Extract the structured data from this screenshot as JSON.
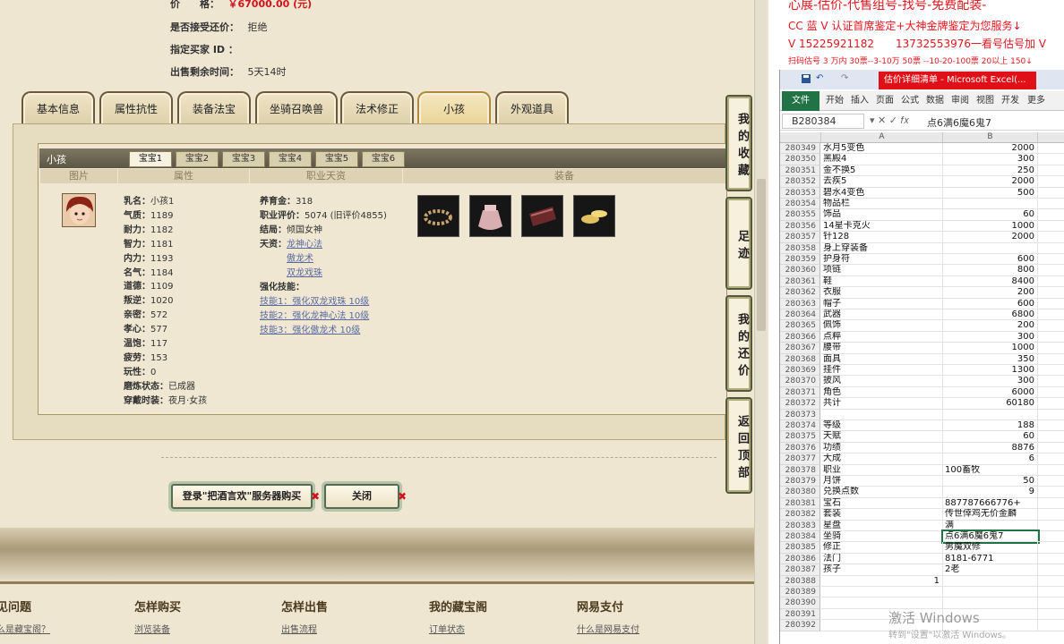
{
  "listing": {
    "price_label": "价　　格：",
    "price_value": "￥67000.00 (元)",
    "counter_offer_label": "是否接受还价：",
    "counter_offer_value": "拒绝",
    "buyer_id_label": "指定买家 ID ：",
    "buyer_id_value": "",
    "time_left_label": "出售剩余时间：",
    "time_left_value": "5天14时"
  },
  "tabs": [
    {
      "label": "基本信息",
      "active": false
    },
    {
      "label": "属性抗性",
      "active": false
    },
    {
      "label": "装备法宝",
      "active": false
    },
    {
      "label": "坐骑召唤兽",
      "active": false
    },
    {
      "label": "法术修正",
      "active": false
    },
    {
      "label": "小孩",
      "active": true
    },
    {
      "label": "外观道具",
      "active": false
    }
  ],
  "child_panel": {
    "title": "小孩",
    "baby_tabs": [
      "宝宝1",
      "宝宝2",
      "宝宝3",
      "宝宝4",
      "宝宝5",
      "宝宝6"
    ],
    "columns": [
      "图片",
      "属性",
      "职业天资",
      "装备"
    ],
    "attributes": [
      {
        "k": "乳名：",
        "v": "小孩1"
      },
      {
        "k": "气质：",
        "v": "1189"
      },
      {
        "k": "耐力：",
        "v": "1182"
      },
      {
        "k": "智力：",
        "v": "1181"
      },
      {
        "k": "内力：",
        "v": "1193"
      },
      {
        "k": "名气：",
        "v": "1184"
      },
      {
        "k": "道德：",
        "v": "1109"
      },
      {
        "k": "叛逆：",
        "v": "1020"
      },
      {
        "k": "亲密：",
        "v": "572"
      },
      {
        "k": "孝心：",
        "v": "577"
      },
      {
        "k": "温饱：",
        "v": "117"
      },
      {
        "k": "疲劳：",
        "v": "153"
      },
      {
        "k": "玩性：",
        "v": "0"
      },
      {
        "k": "磨炼状态：",
        "v": "已成器"
      },
      {
        "k": "穿戴时装：",
        "v": "夜月·女孩"
      }
    ],
    "career": {
      "fund_label": "养育金：",
      "fund_value": "318",
      "eval_label": "职业评价：",
      "eval_value": "5074 (旧评价4855)",
      "ending_label": "结局：",
      "ending_value": "倾国女神",
      "talent_label": "天资：",
      "talents": [
        "龙神心法",
        "傲龙术",
        "双龙戏珠"
      ],
      "skill_label": "强化技能：",
      "skills": [
        "技能1：强化双龙戏珠 10级",
        "技能2：强化龙神心法 10级",
        "技能3：强化傲龙术 10级"
      ]
    },
    "equipment_icons": [
      "ring-icon",
      "pouch-icon",
      "bracer-icon",
      "gold-ingot-icon"
    ]
  },
  "buttons": {
    "buy": "登录\"把酒言欢\"服务器购买",
    "close": "关闭"
  },
  "side_tabs": [
    "我的收藏",
    "足迹",
    "我的还价",
    "返回顶部"
  ],
  "footer": [
    {
      "heading": "见问题",
      "link": "么是藏宝阁？"
    },
    {
      "heading": "怎样购买",
      "link": "浏览装备"
    },
    {
      "heading": "怎样出售",
      "link": "出售流程"
    },
    {
      "heading": "我的藏宝阁",
      "link": "订单状态"
    },
    {
      "heading": "网易支付",
      "link": "什么是网易支付"
    }
  ],
  "ad": {
    "line1": "心展-估价-代售组号-找号-免费配装-",
    "line2": "CC 蓝 V 认证首席鉴定+大神金牌鉴定为您服务↓",
    "line3": "V 15225921182　　13732553976一看号估号加 V",
    "line4": "扫码估号 3 万内 30票--3-10万 50票 --10-20-100票 20以上 150↓"
  },
  "excel": {
    "title": "估价详细清单 - Microsoft Excel(...",
    "ribbon_tabs": [
      "文件",
      "开始",
      "插入",
      "页面",
      "公式",
      "数据",
      "审阅",
      "视图",
      "开发",
      "更多"
    ],
    "name_box": "B280384",
    "formula": "点6满6魔6鬼7",
    "col_headers": [
      "A",
      "B"
    ],
    "rows": [
      {
        "n": "280349",
        "a": "水月5变色",
        "b": "2000"
      },
      {
        "n": "280350",
        "a": "黑殿4",
        "b": "300"
      },
      {
        "n": "280351",
        "a": "金不换5",
        "b": "250"
      },
      {
        "n": "280352",
        "a": "去疾5",
        "b": "2000"
      },
      {
        "n": "280353",
        "a": "碧水4变色",
        "b": "500"
      },
      {
        "n": "280354",
        "a": "物品栏",
        "b": ""
      },
      {
        "n": "280355",
        "a": "饰品",
        "b": "60"
      },
      {
        "n": "280356",
        "a": "14星卡克火",
        "b": "1000"
      },
      {
        "n": "280357",
        "a": "针128",
        "b": "2000"
      },
      {
        "n": "280358",
        "a": "身上穿装备",
        "b": ""
      },
      {
        "n": "280359",
        "a": "护身符",
        "b": "600"
      },
      {
        "n": "280360",
        "a": "项链",
        "b": "800"
      },
      {
        "n": "280361",
        "a": "鞋",
        "b": "8400"
      },
      {
        "n": "280362",
        "a": "衣服",
        "b": "200"
      },
      {
        "n": "280363",
        "a": "帽子",
        "b": "600"
      },
      {
        "n": "280364",
        "a": "武器",
        "b": "6800"
      },
      {
        "n": "280365",
        "a": "佩饰",
        "b": "200"
      },
      {
        "n": "280366",
        "a": "点粹",
        "b": "300"
      },
      {
        "n": "280367",
        "a": "腰带",
        "b": "1000"
      },
      {
        "n": "280368",
        "a": "面具",
        "b": "350"
      },
      {
        "n": "280369",
        "a": "挂件",
        "b": "1300"
      },
      {
        "n": "280370",
        "a": "披风",
        "b": "300"
      },
      {
        "n": "280371",
        "a": "角色",
        "b": "6000"
      },
      {
        "n": "280372",
        "a": "共计",
        "b": "60180"
      },
      {
        "n": "280373",
        "a": "",
        "b": ""
      },
      {
        "n": "280374",
        "a": "等级",
        "b": "188"
      },
      {
        "n": "280375",
        "a": "天赋",
        "b": "60"
      },
      {
        "n": "280376",
        "a": "功绩",
        "b": "8876"
      },
      {
        "n": "280377",
        "a": "大成",
        "b": "6"
      },
      {
        "n": "280378",
        "a": "职业",
        "b": "100畜牧",
        "bt": "txt"
      },
      {
        "n": "280379",
        "a": "月饼",
        "b": "50"
      },
      {
        "n": "280380",
        "a": "兑换点数",
        "b": "9"
      },
      {
        "n": "280381",
        "a": "宝石",
        "b": "887787666776+",
        "bt": "txt"
      },
      {
        "n": "280382",
        "a": "套装",
        "b": "传世倖鸡无价金麟",
        "bt": "txt"
      },
      {
        "n": "280383",
        "a": "星盘",
        "b": "满",
        "bt": "txt"
      },
      {
        "n": "280384",
        "a": "坐骑",
        "b": "点6满6魔6鬼7",
        "bt": "txt"
      },
      {
        "n": "280385",
        "a": "修正",
        "b": "男魔双修",
        "bt": "txt"
      },
      {
        "n": "280386",
        "a": "法门",
        "b": "8181-6771",
        "bt": "txt"
      },
      {
        "n": "280387",
        "a": "孩子",
        "b": "2老",
        "bt": "txt"
      },
      {
        "n": "280388",
        "a": "1",
        "b": "",
        "at": "num"
      },
      {
        "n": "280389",
        "a": "",
        "b": ""
      },
      {
        "n": "280390",
        "a": "",
        "b": ""
      },
      {
        "n": "280391",
        "a": "",
        "b": ""
      },
      {
        "n": "280392",
        "a": "",
        "b": ""
      }
    ],
    "watermark": "激活 Windows",
    "watermark_sub": "转到\"设置\"以激活 Windows。"
  }
}
